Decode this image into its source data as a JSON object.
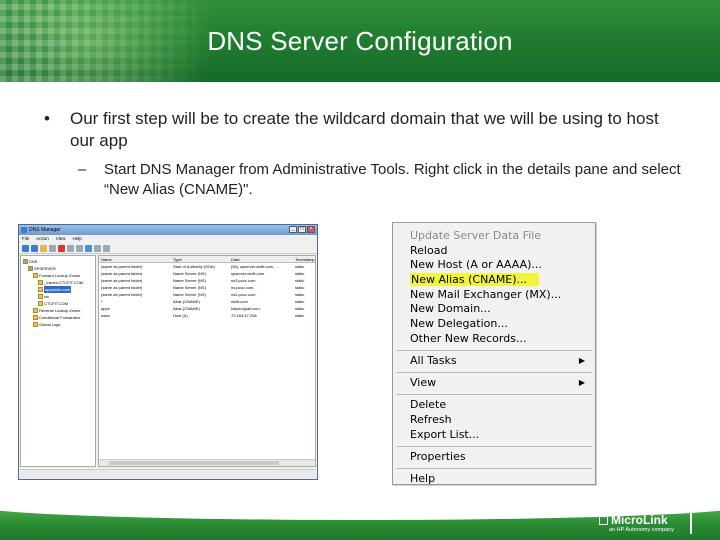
{
  "slide": {
    "title": "DNS Server Configuration",
    "bullet1": "Our first step will be to create the wildcard domain that we will be using to host our app",
    "bullet2": "Start DNS Manager from Administrative Tools. Right click in the details pane and select “New Alias (CNAME)\".",
    "bullet_marker": "•",
    "sub_marker": "–"
  },
  "dns_window": {
    "title": "DNS Manager",
    "menu": [
      "File",
      "Action",
      "View",
      "Help"
    ],
    "tree": [
      {
        "label": "DNS",
        "indent": 0
      },
      {
        "label": "SPSERVER",
        "indent": 1
      },
      {
        "label": "Forward Lookup Zones",
        "indent": 2
      },
      {
        "label": "_msdcs.CTCFIT.COM",
        "indent": 3
      },
      {
        "label": "appstodo.com",
        "indent": 3,
        "selected": true
      },
      {
        "label": "ctc",
        "indent": 3
      },
      {
        "label": "CTCFIT.COM",
        "indent": 3
      },
      {
        "label": "Reverse Lookup Zones",
        "indent": 2
      },
      {
        "label": "Conditional Forwarders",
        "indent": 2
      },
      {
        "label": "Global Logs",
        "indent": 2
      }
    ],
    "columns": [
      "Name",
      "Type",
      "Data",
      "Timestamp"
    ],
    "rows": [
      [
        "(same as parent folder)",
        "Start of Authority (SOA)",
        "[36], spserver.ctcfit.com., ...",
        "static"
      ],
      [
        "(same as parent folder)",
        "Name Server (NS)",
        "spserver.ctcfit.com.",
        "static"
      ],
      [
        "(same as parent folder)",
        "Name Server (NS)",
        "ns3.pccc.com.",
        "static"
      ],
      [
        "(same as parent folder)",
        "Name Server (NS)",
        "ns.pccc.com.",
        "static"
      ],
      [
        "(same as parent folder)",
        "Name Server (NS)",
        "ns2.pccc.com.",
        "static"
      ],
      [
        "*",
        "Alias (CNAME)",
        "ctcfit.com.",
        "static"
      ],
      [
        "apps",
        "Alias (CNAME)",
        "tollymcgrail.com.",
        "static"
      ],
      [
        "www",
        "Host (A)",
        "70.164.47.208",
        "static"
      ]
    ]
  },
  "context_menu": {
    "groups": [
      [
        {
          "label": "Update Server Data File",
          "disabled": true
        },
        {
          "label": "Reload"
        },
        {
          "label": "New Host (A or AAAA)..."
        },
        {
          "label": "New Alias (CNAME)...",
          "highlight": true
        },
        {
          "label": "New Mail Exchanger (MX)..."
        },
        {
          "label": "New Domain..."
        },
        {
          "label": "New Delegation..."
        },
        {
          "label": "Other New Records..."
        }
      ],
      [
        {
          "label": "All Tasks",
          "submenu": true
        }
      ],
      [
        {
          "label": "View",
          "submenu": true
        }
      ],
      [
        {
          "label": "Delete"
        },
        {
          "label": "Refresh"
        },
        {
          "label": "Export List..."
        }
      ],
      [
        {
          "label": "Properties"
        }
      ],
      [
        {
          "label": "Help"
        }
      ]
    ],
    "submenu_arrow": "▶"
  },
  "footer": {
    "logo": "MicroLink",
    "tagline": "an HP Autonomy company"
  },
  "colors": {
    "brand_green": "#2a8a35",
    "highlight_yellow": "#f2f53a"
  }
}
